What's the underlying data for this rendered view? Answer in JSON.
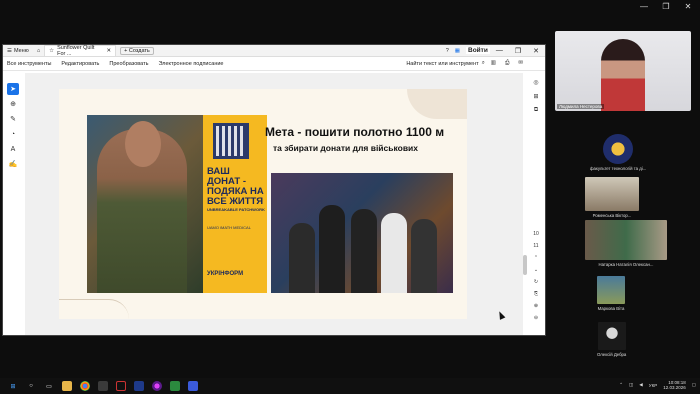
{
  "viewer": {
    "menu_label": "Меню",
    "tab_title": "Sunflower Quilt For ...",
    "new_tab_label": "Создать",
    "signin_label": "Войти",
    "toolbar": {
      "all_tools": "Все инструменты",
      "edit": "Редактировать",
      "convert": "Преобразовать",
      "esign": "Электронное подписание",
      "search": "Найти текст или инструмент"
    },
    "page_numbers": [
      "10",
      "11"
    ]
  },
  "document": {
    "headline": "Мета - пошити полотно 1100 м",
    "subheadline": "та збирати донати для військових",
    "panel_big": "ВАШ ДОНАТ - ПОДЯКА НА ВСЕ ЖИТТЯ",
    "panel_small": "UNBREAKABLE PATCHWORK",
    "panel_logos": "UAMO  iMATH MEDICAL",
    "panel_brand": "УКРІНФОРМ"
  },
  "meeting": {
    "speaker_name": "Людмила Нестерова",
    "participants": [
      {
        "name": "факультет технологій та ді..."
      },
      {
        "name": "Роменська Віктор..."
      },
      {
        "name": "Натарка Наталія Олексан..."
      },
      {
        "name": "Маркова Віта"
      },
      {
        "name": "Олексій Дебра"
      }
    ]
  },
  "taskbar": {
    "lang": "УКР",
    "time": "10:08:18",
    "date": "12.03.2026"
  },
  "colors": {
    "accent": "#1a73e8",
    "poster_yellow": "#f5b921",
    "poster_navy": "#1d2a5a",
    "page_bg": "#fbf6ec"
  }
}
